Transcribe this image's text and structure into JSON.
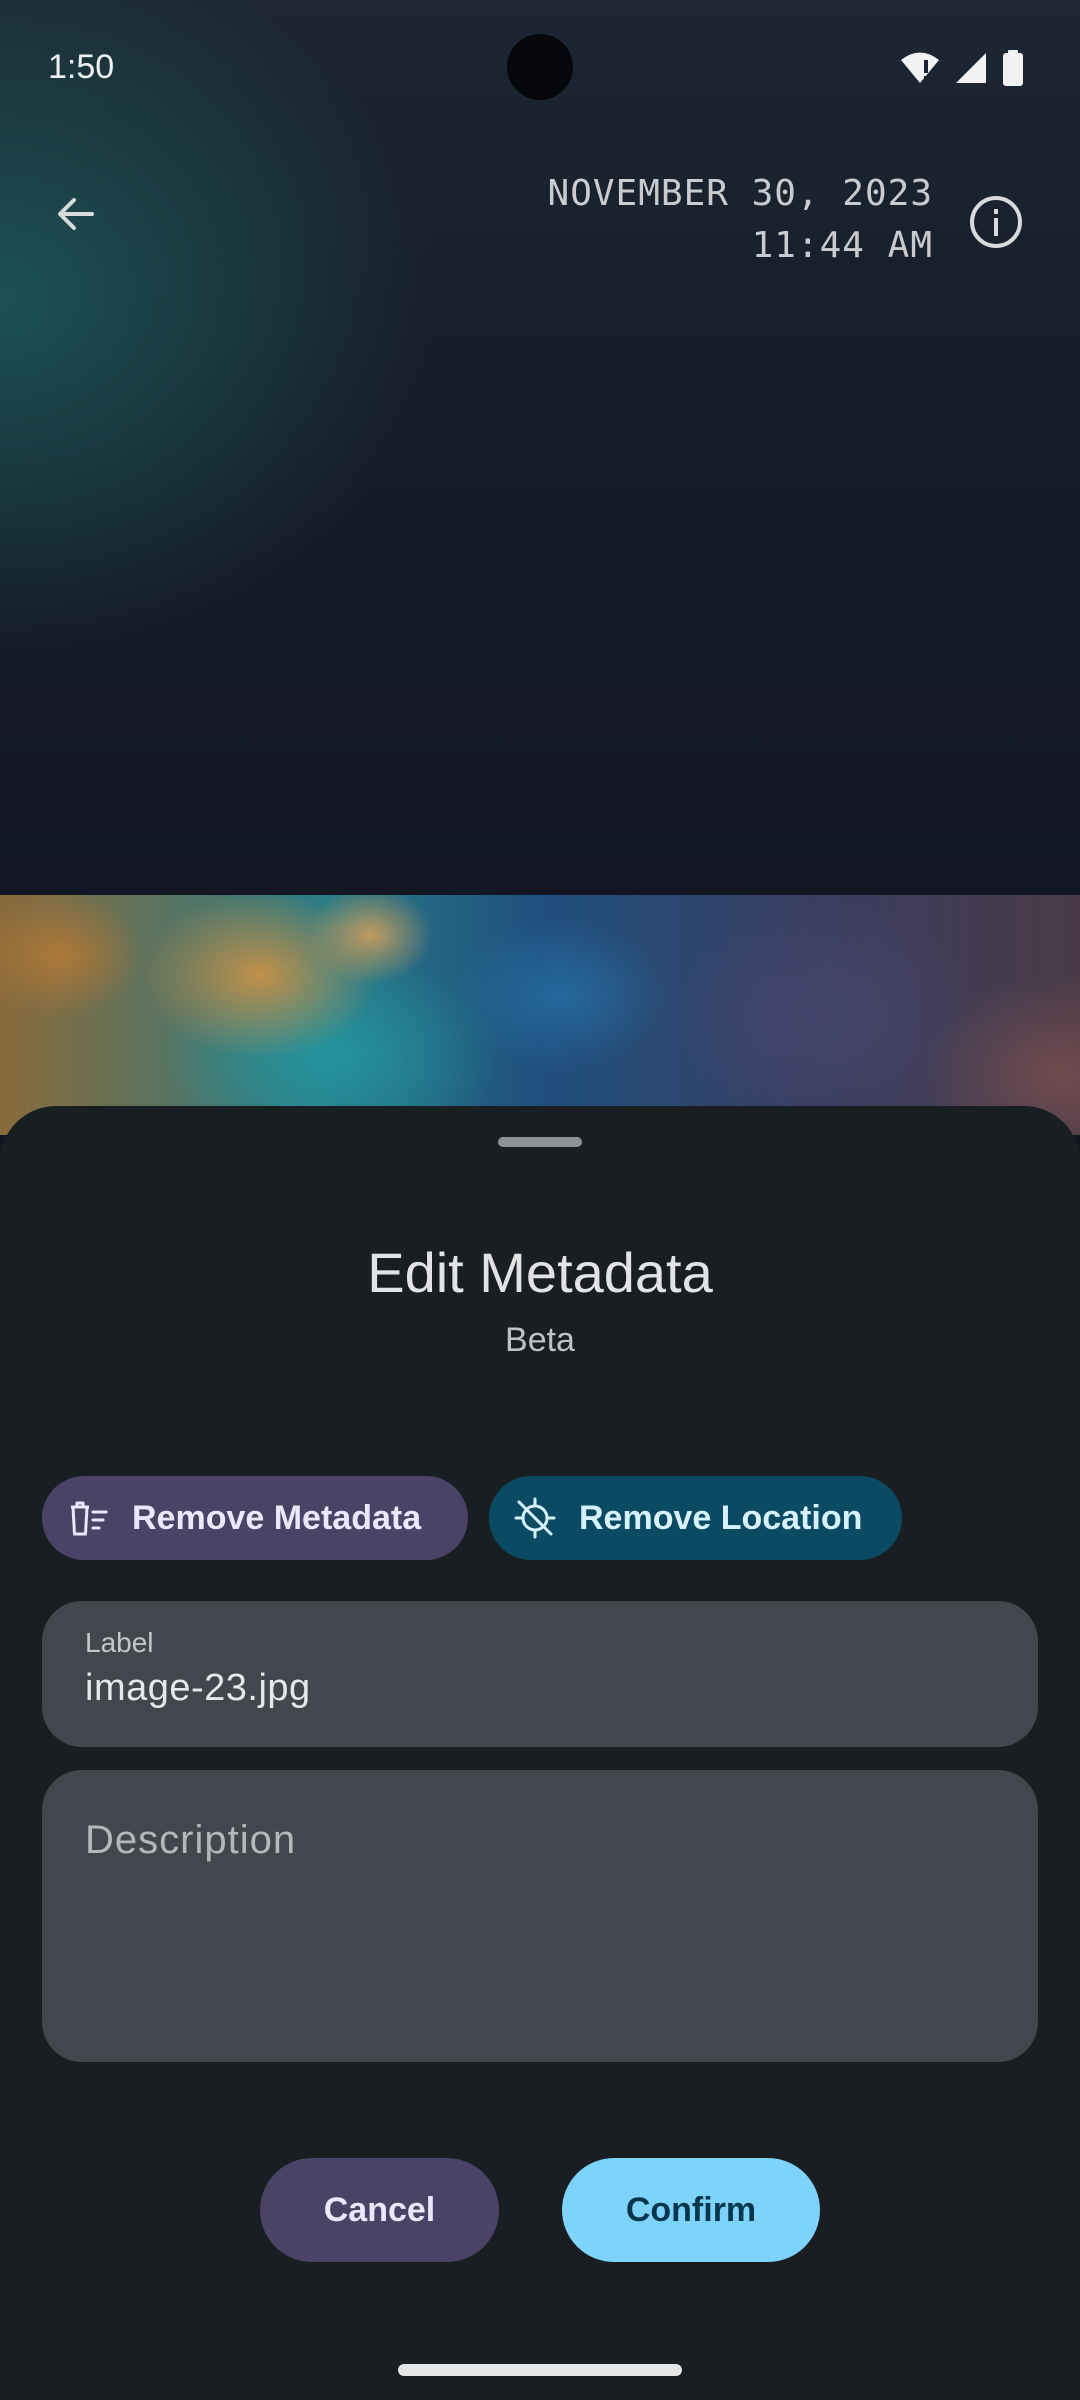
{
  "status_bar": {
    "time": "1:50",
    "icons": [
      "wifi-alert-icon",
      "cell-signal-icon",
      "battery-icon"
    ]
  },
  "header": {
    "date": "NOVEMBER 30, 2023",
    "time": "11:44 AM",
    "back_icon": "arrow-back-icon",
    "info_icon": "info-icon"
  },
  "sheet": {
    "title": "Edit Metadata",
    "subtitle": "Beta",
    "chips": {
      "remove_metadata": "Remove Metadata",
      "remove_location": "Remove Location"
    },
    "label_field": {
      "caption": "Label",
      "value": "image-23.jpg"
    },
    "description_field": {
      "placeholder": "Description",
      "value": ""
    },
    "buttons": {
      "cancel": "Cancel",
      "confirm": "Confirm"
    }
  },
  "colors": {
    "sheet_bg": "#191e22",
    "field_bg": "#41474d",
    "chip_metadata_bg": "#4a4366",
    "chip_location_bg": "#0a4b63",
    "confirm_bg": "#7dd3fc",
    "cancel_bg": "#4a4366"
  }
}
